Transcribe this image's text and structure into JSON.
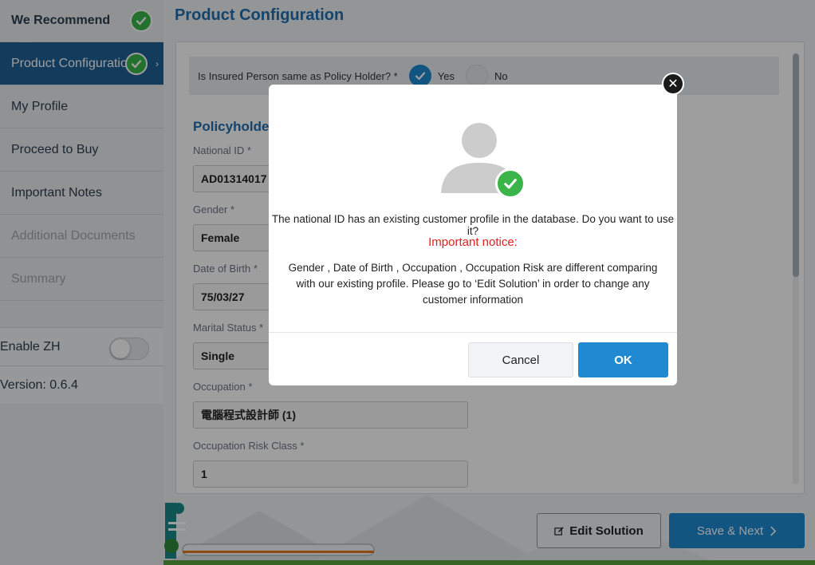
{
  "sidebar": {
    "items": [
      {
        "label": "We Recommend",
        "state": "completed"
      },
      {
        "label": "Product Configuration",
        "state": "active-completed"
      },
      {
        "label": "My Profile",
        "state": "enabled"
      },
      {
        "label": "Proceed to Buy",
        "state": "enabled"
      },
      {
        "label": "Important Notes",
        "state": "enabled"
      },
      {
        "label": "Additional Documents",
        "state": "disabled"
      },
      {
        "label": "Summary",
        "state": "disabled"
      }
    ],
    "enable_zh_label": "Enable ZH",
    "enable_zh_on": false,
    "version_label": "Version: 0.6.4"
  },
  "main": {
    "page_title": "Product Configuration",
    "question": {
      "label": "Is Insured Person same as Policy Holder? *",
      "yes_label": "Yes",
      "no_label": "No",
      "selected": "Yes"
    },
    "section_title": "Policyholder I",
    "fields": [
      {
        "label": "National ID *",
        "value": "AD01314017"
      },
      {
        "label": "Gender *",
        "value": "Female"
      },
      {
        "label": "Date of Birth *",
        "value": "75/03/27"
      },
      {
        "label": "Marital Status *",
        "value": "Single"
      },
      {
        "label": "Occupation *",
        "value": "電腦程式設計師 (1)"
      },
      {
        "label": "Occupation Risk Class *",
        "value": "1"
      }
    ]
  },
  "footer": {
    "edit_label": "Edit Solution",
    "save_label": "Save & Next"
  },
  "modal": {
    "message": "The national ID has an existing customer profile in the database. Do you want to use it?",
    "notice_title": "Important notice:",
    "detail": "Gender , Date of Birth , Occupation , Occupation Risk are different comparing with our existing profile. Please go to ‘Edit Solution’ in order to change any customer information",
    "cancel_label": "Cancel",
    "ok_label": "OK"
  },
  "colors": {
    "primary_blue": "#1f8ad1",
    "nav_active": "#1f5f95",
    "title_blue": "#1f6fb0",
    "success_green": "#3bb54a",
    "notice_red": "#e02020"
  }
}
